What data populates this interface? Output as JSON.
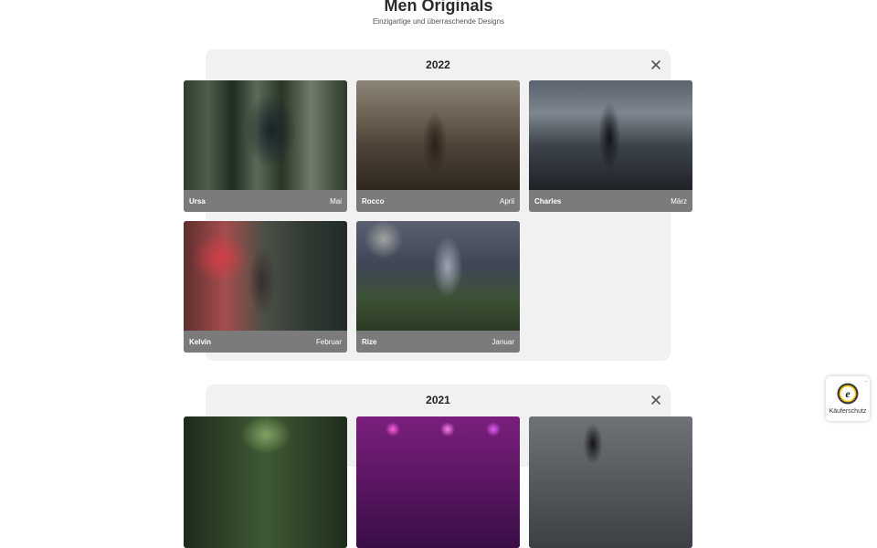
{
  "header": {
    "title": "Men Originals",
    "subtitle": "Einzigartige und überraschende Designs"
  },
  "years": [
    {
      "label": "2022",
      "close_icon": "close-icon",
      "items": [
        {
          "name": "Ursa",
          "month": "Mai"
        },
        {
          "name": "Rocco",
          "month": "April"
        },
        {
          "name": "Charles",
          "month": "März"
        },
        {
          "name": "Kelvin",
          "month": "Februar"
        },
        {
          "name": "Rize",
          "month": "Januar"
        }
      ]
    },
    {
      "label": "2021",
      "close_icon": "close-icon",
      "items": [
        {
          "name": "",
          "month": ""
        },
        {
          "name": "",
          "month": ""
        },
        {
          "name": "",
          "month": ""
        }
      ]
    }
  ],
  "trust_badge": {
    "seal_letter": "e",
    "label": "Käuferschutz",
    "menu_dots": "..."
  },
  "colors": {
    "panel_background": "#f1f1f1",
    "caption_background": "#7b7b7b",
    "title_text": "#2b2b2b"
  }
}
